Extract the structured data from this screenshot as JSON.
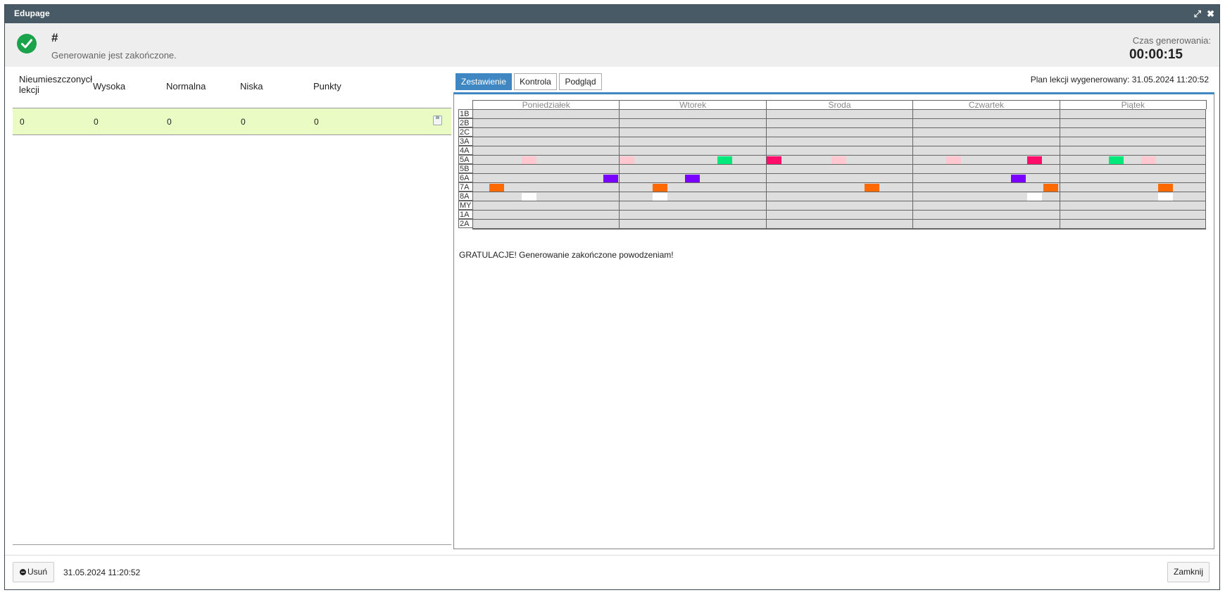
{
  "window": {
    "title": "Edupage"
  },
  "header": {
    "title": "#",
    "status": "Generowanie jest zakończone.",
    "time_label": "Czas generowania:",
    "time_value": "00:00:15"
  },
  "summary_table": {
    "headers": [
      "Nieumieszczonych lekcji",
      "Wysoka",
      "Normalna",
      "Niska",
      "Punkty"
    ],
    "header_lines": {
      "col0_line1": "Nieumieszczonycł",
      "col0_line2": "lekcji"
    },
    "row": [
      "0",
      "0",
      "0",
      "0",
      "0"
    ],
    "row_icon": "save-icon"
  },
  "tabs": [
    "Zestawienie",
    "Kontrola",
    "Podgląd"
  ],
  "active_tab": "Zestawienie",
  "plan_info": "Plan lekcji wygenerowany: 31.05.2024 11:20:52",
  "timetable": {
    "days": [
      "Poniedziałek",
      "Wtorek",
      "Środa",
      "Czwartek",
      "Piątek"
    ],
    "classes": [
      "1B",
      "2B",
      "2C",
      "3A",
      "4A",
      "5A",
      "5B",
      "6A",
      "7A",
      "8A",
      "MY",
      "1A",
      "2A"
    ],
    "periods_per_day": 8,
    "blocks": [
      {
        "class": "5A",
        "day": 0,
        "period": 3,
        "color": "#ffc7cf"
      },
      {
        "class": "5A",
        "day": 1,
        "period": 0,
        "color": "#ffc7cf"
      },
      {
        "class": "5A",
        "day": 1,
        "period": 6,
        "color": "#00e97a"
      },
      {
        "class": "5A",
        "day": 2,
        "period": 0,
        "color": "#ff0d6a"
      },
      {
        "class": "5A",
        "day": 2,
        "period": 4,
        "color": "#ffc7cf"
      },
      {
        "class": "5A",
        "day": 3,
        "period": 2,
        "color": "#ffc7cf"
      },
      {
        "class": "5A",
        "day": 3,
        "period": 7,
        "color": "#ff0d6a"
      },
      {
        "class": "5A",
        "day": 4,
        "period": 3,
        "color": "#00e97a"
      },
      {
        "class": "5A",
        "day": 4,
        "period": 5,
        "color": "#ffc7cf"
      },
      {
        "class": "6A",
        "day": 0,
        "period": 8,
        "color": "#7a00ff"
      },
      {
        "class": "6A",
        "day": 1,
        "period": 4,
        "color": "#7a00ff"
      },
      {
        "class": "6A",
        "day": 3,
        "period": 6,
        "color": "#7a00ff"
      },
      {
        "class": "7A",
        "day": 0,
        "period": 1,
        "color": "#ff6a00"
      },
      {
        "class": "7A",
        "day": 1,
        "period": 2,
        "color": "#ff6a00"
      },
      {
        "class": "7A",
        "day": 2,
        "period": 6,
        "color": "#ff6a00"
      },
      {
        "class": "7A",
        "day": 3,
        "period": 8,
        "color": "#ff6a00"
      },
      {
        "class": "7A",
        "day": 4,
        "period": 6,
        "color": "#ff6a00"
      },
      {
        "class": "8A",
        "day": 0,
        "period": 3,
        "color": "#ffffff"
      },
      {
        "class": "8A",
        "day": 1,
        "period": 2,
        "color": "#ffffff"
      },
      {
        "class": "8A",
        "day": 3,
        "period": 7,
        "color": "#ffffff"
      },
      {
        "class": "8A",
        "day": 4,
        "period": 6,
        "color": "#ffffff"
      }
    ]
  },
  "message": "GRATULACJE! Generowanie zakończone powodzeniam!",
  "footer": {
    "delete_label": "Usuń",
    "date": "31.05.2024 11:20:52",
    "close_label": "Zamknij"
  },
  "colors": {
    "titlebar": "#485a65",
    "accent": "#3f87c3",
    "success": "#1aa34a",
    "row_highlight": "#eafbc4"
  }
}
